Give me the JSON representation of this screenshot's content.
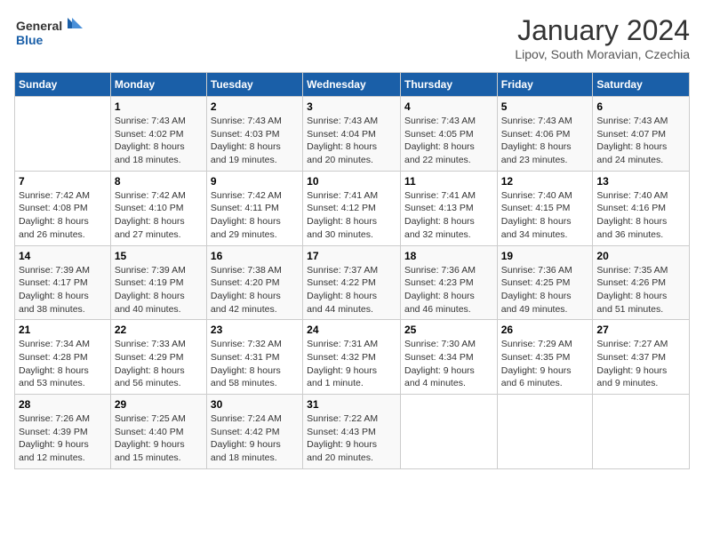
{
  "header": {
    "logo_line1": "General",
    "logo_line2": "Blue",
    "title": "January 2024",
    "subtitle": "Lipov, South Moravian, Czechia"
  },
  "weekdays": [
    "Sunday",
    "Monday",
    "Tuesday",
    "Wednesday",
    "Thursday",
    "Friday",
    "Saturday"
  ],
  "weeks": [
    [
      {
        "day": "",
        "info": ""
      },
      {
        "day": "1",
        "info": "Sunrise: 7:43 AM\nSunset: 4:02 PM\nDaylight: 8 hours\nand 18 minutes."
      },
      {
        "day": "2",
        "info": "Sunrise: 7:43 AM\nSunset: 4:03 PM\nDaylight: 8 hours\nand 19 minutes."
      },
      {
        "day": "3",
        "info": "Sunrise: 7:43 AM\nSunset: 4:04 PM\nDaylight: 8 hours\nand 20 minutes."
      },
      {
        "day": "4",
        "info": "Sunrise: 7:43 AM\nSunset: 4:05 PM\nDaylight: 8 hours\nand 22 minutes."
      },
      {
        "day": "5",
        "info": "Sunrise: 7:43 AM\nSunset: 4:06 PM\nDaylight: 8 hours\nand 23 minutes."
      },
      {
        "day": "6",
        "info": "Sunrise: 7:43 AM\nSunset: 4:07 PM\nDaylight: 8 hours\nand 24 minutes."
      }
    ],
    [
      {
        "day": "7",
        "info": "Sunrise: 7:42 AM\nSunset: 4:08 PM\nDaylight: 8 hours\nand 26 minutes."
      },
      {
        "day": "8",
        "info": "Sunrise: 7:42 AM\nSunset: 4:10 PM\nDaylight: 8 hours\nand 27 minutes."
      },
      {
        "day": "9",
        "info": "Sunrise: 7:42 AM\nSunset: 4:11 PM\nDaylight: 8 hours\nand 29 minutes."
      },
      {
        "day": "10",
        "info": "Sunrise: 7:41 AM\nSunset: 4:12 PM\nDaylight: 8 hours\nand 30 minutes."
      },
      {
        "day": "11",
        "info": "Sunrise: 7:41 AM\nSunset: 4:13 PM\nDaylight: 8 hours\nand 32 minutes."
      },
      {
        "day": "12",
        "info": "Sunrise: 7:40 AM\nSunset: 4:15 PM\nDaylight: 8 hours\nand 34 minutes."
      },
      {
        "day": "13",
        "info": "Sunrise: 7:40 AM\nSunset: 4:16 PM\nDaylight: 8 hours\nand 36 minutes."
      }
    ],
    [
      {
        "day": "14",
        "info": "Sunrise: 7:39 AM\nSunset: 4:17 PM\nDaylight: 8 hours\nand 38 minutes."
      },
      {
        "day": "15",
        "info": "Sunrise: 7:39 AM\nSunset: 4:19 PM\nDaylight: 8 hours\nand 40 minutes."
      },
      {
        "day": "16",
        "info": "Sunrise: 7:38 AM\nSunset: 4:20 PM\nDaylight: 8 hours\nand 42 minutes."
      },
      {
        "day": "17",
        "info": "Sunrise: 7:37 AM\nSunset: 4:22 PM\nDaylight: 8 hours\nand 44 minutes."
      },
      {
        "day": "18",
        "info": "Sunrise: 7:36 AM\nSunset: 4:23 PM\nDaylight: 8 hours\nand 46 minutes."
      },
      {
        "day": "19",
        "info": "Sunrise: 7:36 AM\nSunset: 4:25 PM\nDaylight: 8 hours\nand 49 minutes."
      },
      {
        "day": "20",
        "info": "Sunrise: 7:35 AM\nSunset: 4:26 PM\nDaylight: 8 hours\nand 51 minutes."
      }
    ],
    [
      {
        "day": "21",
        "info": "Sunrise: 7:34 AM\nSunset: 4:28 PM\nDaylight: 8 hours\nand 53 minutes."
      },
      {
        "day": "22",
        "info": "Sunrise: 7:33 AM\nSunset: 4:29 PM\nDaylight: 8 hours\nand 56 minutes."
      },
      {
        "day": "23",
        "info": "Sunrise: 7:32 AM\nSunset: 4:31 PM\nDaylight: 8 hours\nand 58 minutes."
      },
      {
        "day": "24",
        "info": "Sunrise: 7:31 AM\nSunset: 4:32 PM\nDaylight: 9 hours\nand 1 minute."
      },
      {
        "day": "25",
        "info": "Sunrise: 7:30 AM\nSunset: 4:34 PM\nDaylight: 9 hours\nand 4 minutes."
      },
      {
        "day": "26",
        "info": "Sunrise: 7:29 AM\nSunset: 4:35 PM\nDaylight: 9 hours\nand 6 minutes."
      },
      {
        "day": "27",
        "info": "Sunrise: 7:27 AM\nSunset: 4:37 PM\nDaylight: 9 hours\nand 9 minutes."
      }
    ],
    [
      {
        "day": "28",
        "info": "Sunrise: 7:26 AM\nSunset: 4:39 PM\nDaylight: 9 hours\nand 12 minutes."
      },
      {
        "day": "29",
        "info": "Sunrise: 7:25 AM\nSunset: 4:40 PM\nDaylight: 9 hours\nand 15 minutes."
      },
      {
        "day": "30",
        "info": "Sunrise: 7:24 AM\nSunset: 4:42 PM\nDaylight: 9 hours\nand 18 minutes."
      },
      {
        "day": "31",
        "info": "Sunrise: 7:22 AM\nSunset: 4:43 PM\nDaylight: 9 hours\nand 20 minutes."
      },
      {
        "day": "",
        "info": ""
      },
      {
        "day": "",
        "info": ""
      },
      {
        "day": "",
        "info": ""
      }
    ]
  ]
}
